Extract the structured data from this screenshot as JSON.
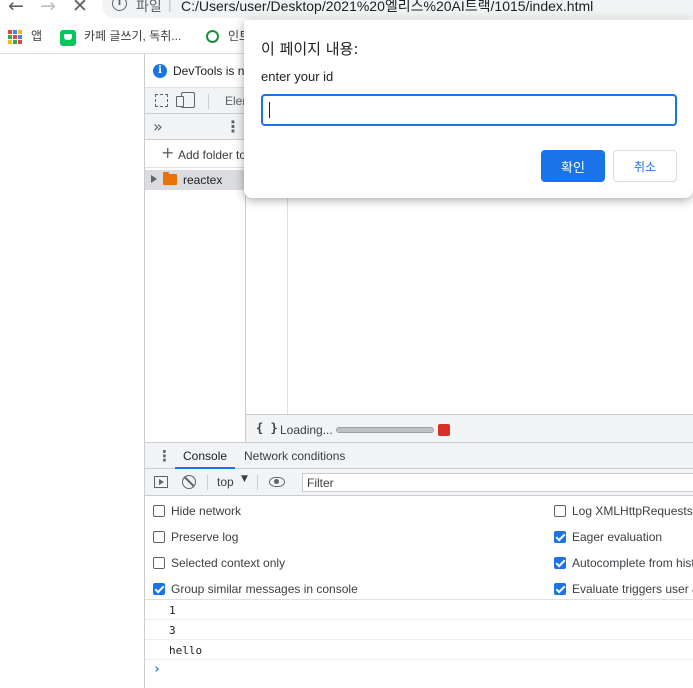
{
  "browser": {
    "address_scheme": "파일",
    "address_url": "C:/Users/user/Desktop/2021%20엘리스%20AI트랙/1015/index.html",
    "bookmarks": [
      {
        "label": "앱",
        "icon": "apps-grid-icon"
      },
      {
        "label": "카페 글쓰기, 독취...",
        "icon": "naver-cafe-icon"
      },
      {
        "label": "인트",
        "icon": "green-circle-icon"
      }
    ]
  },
  "devtools": {
    "notice_text": "DevTools is no",
    "tabs": {
      "elements": "Elem"
    },
    "sources": {
      "add_folder": "Add folder to",
      "tree": [
        {
          "label": "reactex",
          "icon": "folder-icon"
        }
      ]
    },
    "editor_status": {
      "braces": "{ }",
      "loading": "Loading...",
      "progress": 1.0
    },
    "drawer_tabs": [
      {
        "label": "Console",
        "active": true
      },
      {
        "label": "Network conditions",
        "active": false
      }
    ],
    "console_toolbar": {
      "context": "top",
      "filter_placeholder": "Filter"
    },
    "settings": {
      "left": [
        {
          "label": "Hide network",
          "checked": false
        },
        {
          "label": "Preserve log",
          "checked": false
        },
        {
          "label": "Selected context only",
          "checked": false
        },
        {
          "label": "Group similar messages in console",
          "checked": true
        }
      ],
      "right": [
        {
          "label": "Log XMLHttpRequests",
          "checked": false
        },
        {
          "label": "Eager evaluation",
          "checked": true
        },
        {
          "label": "Autocomplete from hist",
          "checked": true
        },
        {
          "label": "Evaluate triggers user a",
          "checked": true
        }
      ]
    },
    "console_messages": [
      "1",
      "3",
      "hello"
    ],
    "prompt_symbol": "›"
  },
  "dialog": {
    "title": "이 페이지 내용:",
    "message": "enter your id",
    "input_value": "",
    "ok_label": "확인",
    "cancel_label": "취소"
  },
  "colors": {
    "accent": "#1a73e8",
    "stop": "#d93025",
    "folder": "#e8710a"
  }
}
